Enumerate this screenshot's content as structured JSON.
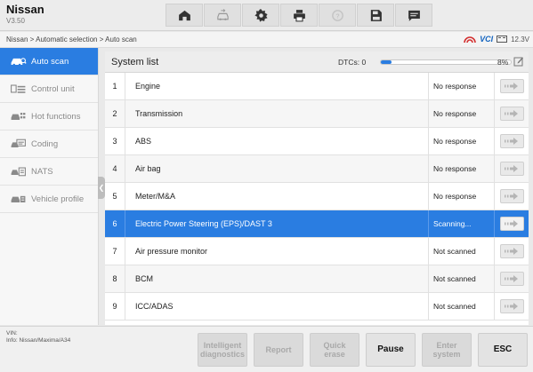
{
  "app": {
    "brand": "Nissan",
    "version": "V3.50"
  },
  "toolbar": {
    "buttons": [
      {
        "icon": "home-icon"
      },
      {
        "icon": "vehicle-swap-icon"
      },
      {
        "icon": "settings-gear-icon"
      },
      {
        "icon": "printer-icon"
      },
      {
        "icon": "help-icon"
      },
      {
        "icon": "save-icon"
      },
      {
        "icon": "message-icon"
      }
    ]
  },
  "breadcrumb": "Nissan > Automatic selection > Auto scan",
  "status": {
    "vci_label": "VCI",
    "battery": "12.3V"
  },
  "sidebar": {
    "items": [
      {
        "label": "Auto scan",
        "icon": "car-scan-icon",
        "active": true
      },
      {
        "label": "Control unit",
        "icon": "control-unit-icon",
        "active": false
      },
      {
        "label": "Hot functions",
        "icon": "hot-functions-icon",
        "active": false
      },
      {
        "label": "Coding",
        "icon": "coding-icon",
        "active": false
      },
      {
        "label": "NATS",
        "icon": "nats-icon",
        "active": false
      },
      {
        "label": "Vehicle profile",
        "icon": "vehicle-profile-icon",
        "active": false
      }
    ]
  },
  "system_list": {
    "title": "System list",
    "dtc_label": "DTCs: 0",
    "progress_percent": 8,
    "progress_text": "8%",
    "rows": [
      {
        "num": "1",
        "name": "Engine",
        "status": "No response"
      },
      {
        "num": "2",
        "name": "Transmission",
        "status": "No response"
      },
      {
        "num": "3",
        "name": "ABS",
        "status": "No response"
      },
      {
        "num": "4",
        "name": "Air bag",
        "status": "No response"
      },
      {
        "num": "5",
        "name": "Meter/M&A",
        "status": "No response"
      },
      {
        "num": "6",
        "name": "Electric Power Steering (EPS)/DAST 3",
        "status": "Scanning...",
        "active": true
      },
      {
        "num": "7",
        "name": "Air pressure monitor",
        "status": "Not scanned"
      },
      {
        "num": "8",
        "name": "BCM",
        "status": "Not scanned"
      },
      {
        "num": "9",
        "name": "ICC/ADAS",
        "status": "Not scanned"
      }
    ]
  },
  "footer": {
    "vin_label": "VIN:",
    "info": "Info: Nissan/Maxima/A34",
    "buttons": [
      {
        "label": "Intelligent diagnostics",
        "enabled": false
      },
      {
        "label": "Report",
        "enabled": false
      },
      {
        "label": "Quick erase",
        "enabled": false
      },
      {
        "label": "Pause",
        "enabled": true
      },
      {
        "label": "Enter system",
        "enabled": false
      },
      {
        "label": "ESC",
        "enabled": true
      }
    ]
  },
  "colors": {
    "accent": "#2a7de1",
    "status_red": "#d32f2f",
    "vci_blue": "#1565c0"
  }
}
